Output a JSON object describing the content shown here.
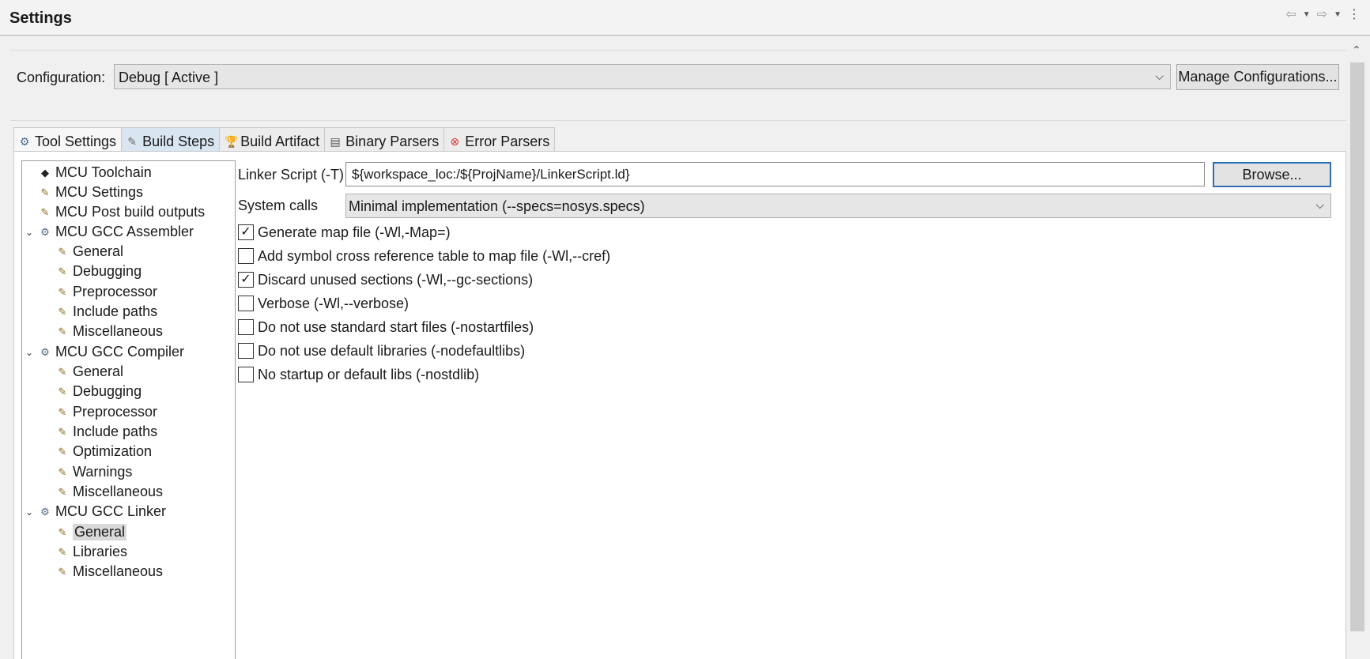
{
  "header": {
    "title": "Settings",
    "nav_icons": [
      "back-arrow-icon",
      "dropdown-icon",
      "forward-arrow-icon",
      "dropdown-icon",
      "more-vertical-icon"
    ]
  },
  "configuration": {
    "label": "Configuration:",
    "value": "Debug  [ Active ]",
    "manage_label": "Manage Configurations..."
  },
  "tabs": [
    {
      "label": "Tool Settings",
      "icon": "tool-settings-icon"
    },
    {
      "label": "Build Steps",
      "icon": "build-steps-icon"
    },
    {
      "label": "Build Artifact",
      "icon": "trophy-icon"
    },
    {
      "label": "Binary Parsers",
      "icon": "binary-icon"
    },
    {
      "label": "Error Parsers",
      "icon": "error-icon"
    }
  ],
  "tree": [
    {
      "label": "MCU Toolchain"
    },
    {
      "label": "MCU Settings"
    },
    {
      "label": "MCU Post build outputs"
    },
    {
      "label": "MCU GCC Assembler"
    },
    {
      "label": "General"
    },
    {
      "label": "Debugging"
    },
    {
      "label": "Preprocessor"
    },
    {
      "label": "Include paths"
    },
    {
      "label": "Miscellaneous"
    },
    {
      "label": "MCU GCC Compiler"
    },
    {
      "label": "General"
    },
    {
      "label": "Debugging"
    },
    {
      "label": "Preprocessor"
    },
    {
      "label": "Include paths"
    },
    {
      "label": "Optimization"
    },
    {
      "label": "Warnings"
    },
    {
      "label": "Miscellaneous"
    },
    {
      "label": "MCU GCC Linker"
    },
    {
      "label": "General",
      "selected": true
    },
    {
      "label": "Libraries"
    },
    {
      "label": "Miscellaneous"
    }
  ],
  "linker": {
    "script_label": "Linker Script (-T)",
    "script_value": "${workspace_loc:/${ProjName}/LinkerScript.ld}",
    "browse_label": "Browse...",
    "syscalls_label": "System calls",
    "syscalls_value": "Minimal implementation (--specs=nosys.specs)"
  },
  "options": [
    {
      "label": "Generate map file (-Wl,-Map=)",
      "checked": true
    },
    {
      "label": "Add symbol cross reference table to map file (-Wl,--cref)",
      "checked": false
    },
    {
      "label": "Discard unused sections (-Wl,--gc-sections)",
      "checked": true
    },
    {
      "label": "Verbose (-Wl,--verbose)",
      "checked": false
    },
    {
      "label": "Do not use standard start files (-nostartfiles)",
      "checked": false
    },
    {
      "label": "Do not use default libraries (-nodefaultlibs)",
      "checked": false
    },
    {
      "label": "No startup or default libs (-nostdlib)",
      "checked": false
    }
  ]
}
